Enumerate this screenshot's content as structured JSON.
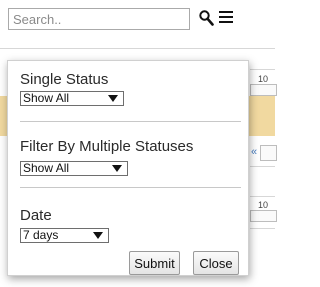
{
  "search": {
    "placeholder": "Search.."
  },
  "header": {
    "search_icon": "search-icon",
    "menu_icon": "hamburger-menu-icon"
  },
  "background": {
    "row_numbers": [
      "10",
      "10"
    ],
    "link_glyph": "«",
    "band_color": "#f1d9a0"
  },
  "filter_panel": {
    "single_status": {
      "label": "Single Status",
      "selected": "Show All"
    },
    "multiple_statuses": {
      "label": "Filter By Multiple Statuses",
      "selected": "Show All"
    },
    "date": {
      "label": "Date",
      "selected": "7 days"
    },
    "buttons": {
      "submit": "Submit",
      "close": "Close"
    }
  }
}
